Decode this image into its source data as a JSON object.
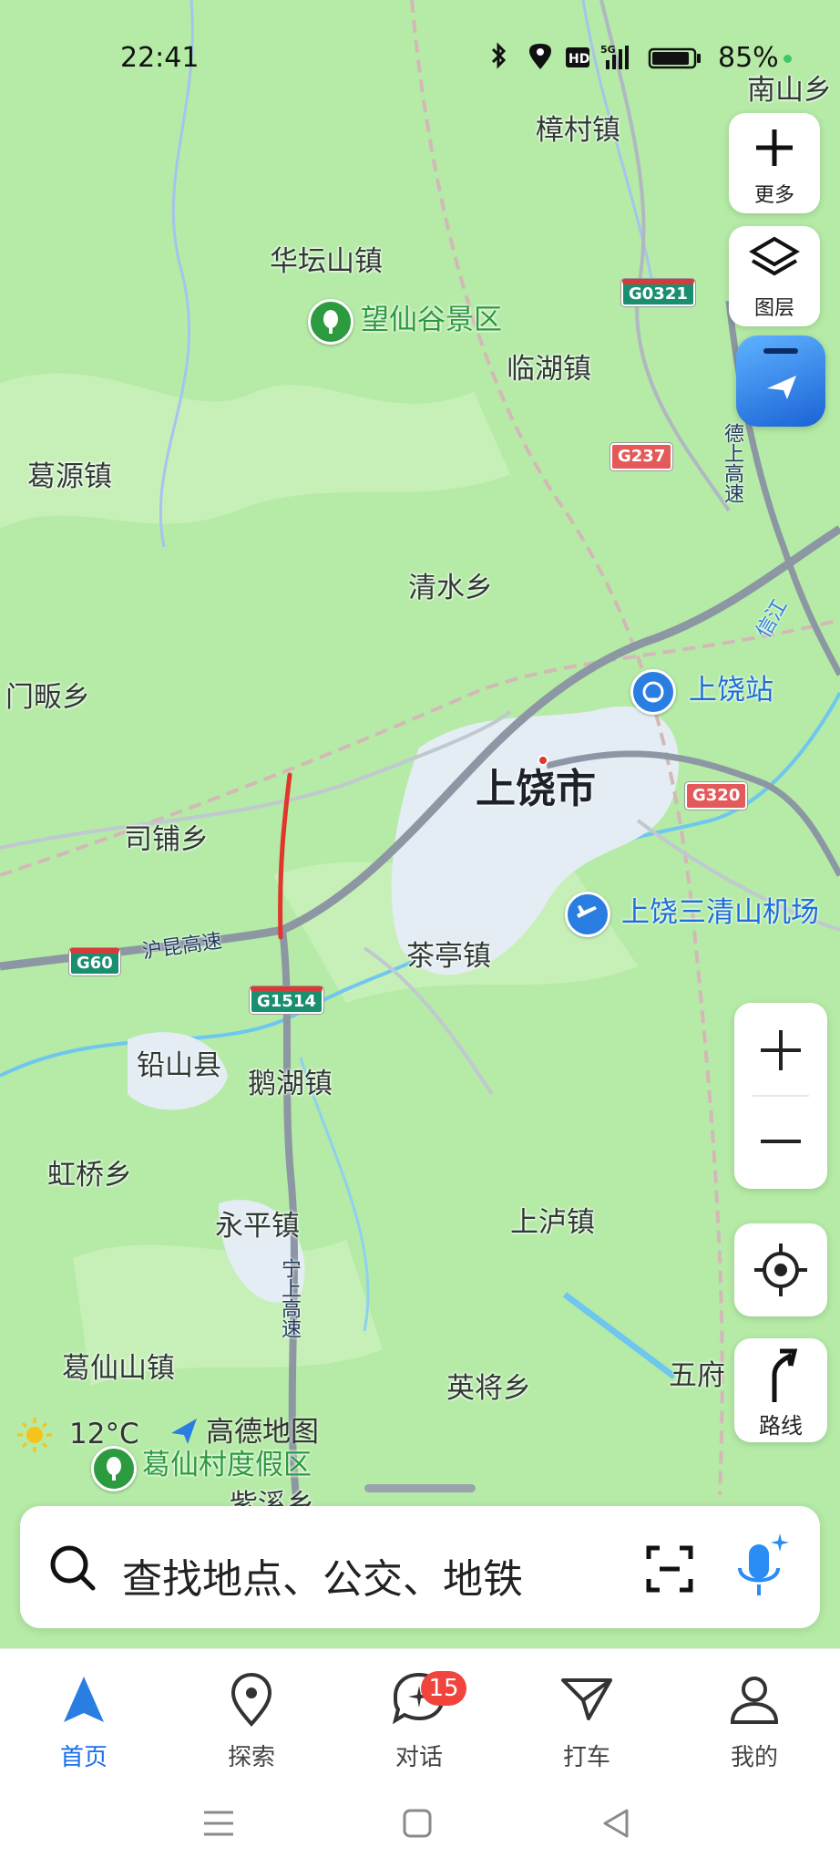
{
  "status_bar": {
    "time": "22:41",
    "battery": "85%",
    "icons": [
      "bluetooth-icon",
      "location-icon",
      "hd-icon",
      "5g-signal-icon",
      "battery-icon"
    ]
  },
  "map": {
    "towns": [
      "南山乡",
      "樟村镇",
      "华坛山镇",
      "临湖镇",
      "葛源镇",
      "清水乡",
      "门畈乡",
      "司铺乡",
      "茶亭镇",
      "铅山县",
      "鹅湖镇",
      "虹桥乡",
      "永平镇",
      "上泸镇",
      "葛仙山镇",
      "英将乡",
      "五府",
      "紫溪乡"
    ],
    "city": "上饶市",
    "stations": {
      "station": "上饶站",
      "airport": "上饶三清山机场"
    },
    "scenic": {
      "wangxian": "望仙谷景区",
      "gexian": "葛仙村度假区"
    },
    "roads": {
      "hukun": "沪昆高速",
      "ningshang": "宁上高速",
      "deshang": "德上高速",
      "xinjiang": "信江"
    },
    "shields": {
      "g0321": "G0321",
      "g237": "G237",
      "g60": "G60",
      "g1514": "G1514",
      "g320": "G320"
    },
    "weather": {
      "temp": "12°C"
    },
    "brand": "高德地图",
    "colors": {
      "land": "#b5eba6",
      "urban": "#e4ecf4",
      "highway": "#8c97a3",
      "route_highlight": "#e0362c",
      "water": "#6fc6ee"
    }
  },
  "controls": {
    "more_label": "更多",
    "layers_label": "图层",
    "route_label": "路线"
  },
  "search": {
    "placeholder": "查找地点、公交、地铁"
  },
  "tabs": [
    {
      "label": "首页",
      "icon": "navigation-arrow-icon",
      "active": true
    },
    {
      "label": "探索",
      "icon": "location-pin-icon"
    },
    {
      "label": "对话",
      "icon": "chat-bubble-icon",
      "badge": "15"
    },
    {
      "label": "打车",
      "icon": "taxi-icon"
    },
    {
      "label": "我的",
      "icon": "person-icon"
    }
  ]
}
